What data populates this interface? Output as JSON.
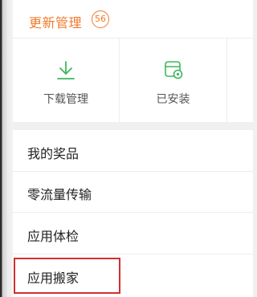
{
  "update_management": {
    "title": "更新管理",
    "count": "56"
  },
  "tools": [
    {
      "label": "下载管理",
      "icon": "download-icon"
    },
    {
      "label": "已安装",
      "icon": "installed-icon"
    }
  ],
  "menu": {
    "items": [
      {
        "label": "我的奖品"
      },
      {
        "label": "零流量传输"
      },
      {
        "label": "应用体检"
      },
      {
        "label": "应用搬家"
      }
    ]
  },
  "colors": {
    "accent": "#f07a2b",
    "icon_green": "#3cb85c",
    "highlight": "#d32f2f"
  }
}
